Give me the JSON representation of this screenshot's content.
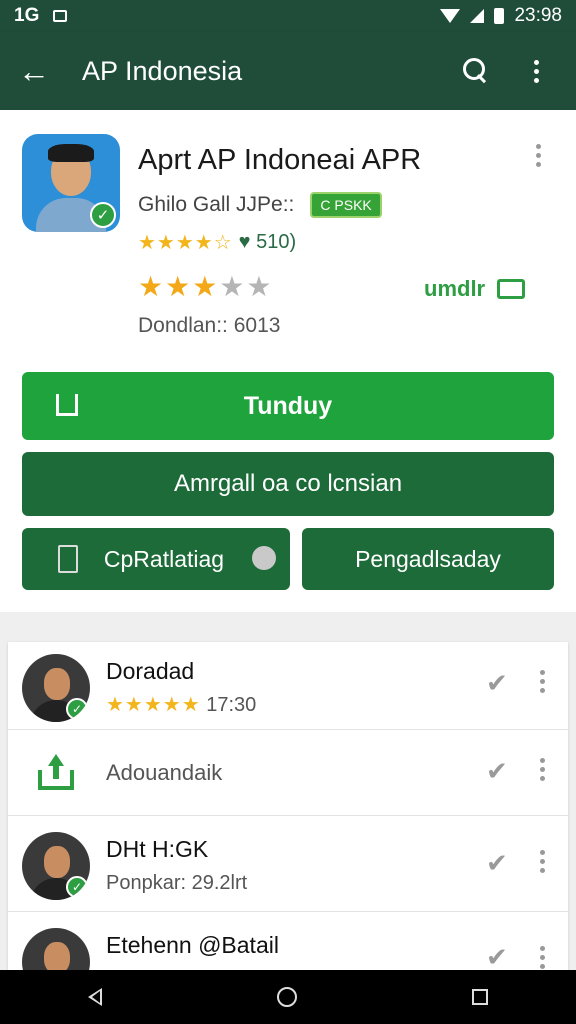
{
  "status_bar": {
    "left_text": "1G",
    "time": "23:98"
  },
  "app_bar": {
    "back_glyph": "←",
    "title": "AP Indonesia"
  },
  "app": {
    "title": "Aprt AP Indoneai APR",
    "developer": "Ghilo Gall JJPe::",
    "chip_text": "C PSKK",
    "rating_text": "♥ 510)",
    "stars_small": "★★★★☆",
    "stars_big_on": "★★★",
    "stars_big_off": "★★",
    "green_label": "umdlr",
    "downloads": "Dondlan:: 6013"
  },
  "buttons": {
    "install": "Tunduy",
    "second": "Amrgall oa co lcnsian",
    "left": "CpRatlatiag",
    "right": "Pengadlsaday"
  },
  "list": [
    {
      "title": "Doradad",
      "stars": "★★★★★",
      "sub": "17:30"
    },
    {
      "title": "",
      "sub": "Adouandaik"
    },
    {
      "title": "DHt H:GK",
      "sub": "Ponpkar: 29.2lrt"
    },
    {
      "title": "Etehenn @Batail",
      "sub": ""
    }
  ],
  "icons": {
    "check": "✔",
    "badge_check": "✓"
  },
  "colors": {
    "app_bar": "#1f4d3a",
    "install_button": "#1fa33c",
    "secondary_button": "#1e6b3a",
    "star": "#f2b51b"
  }
}
